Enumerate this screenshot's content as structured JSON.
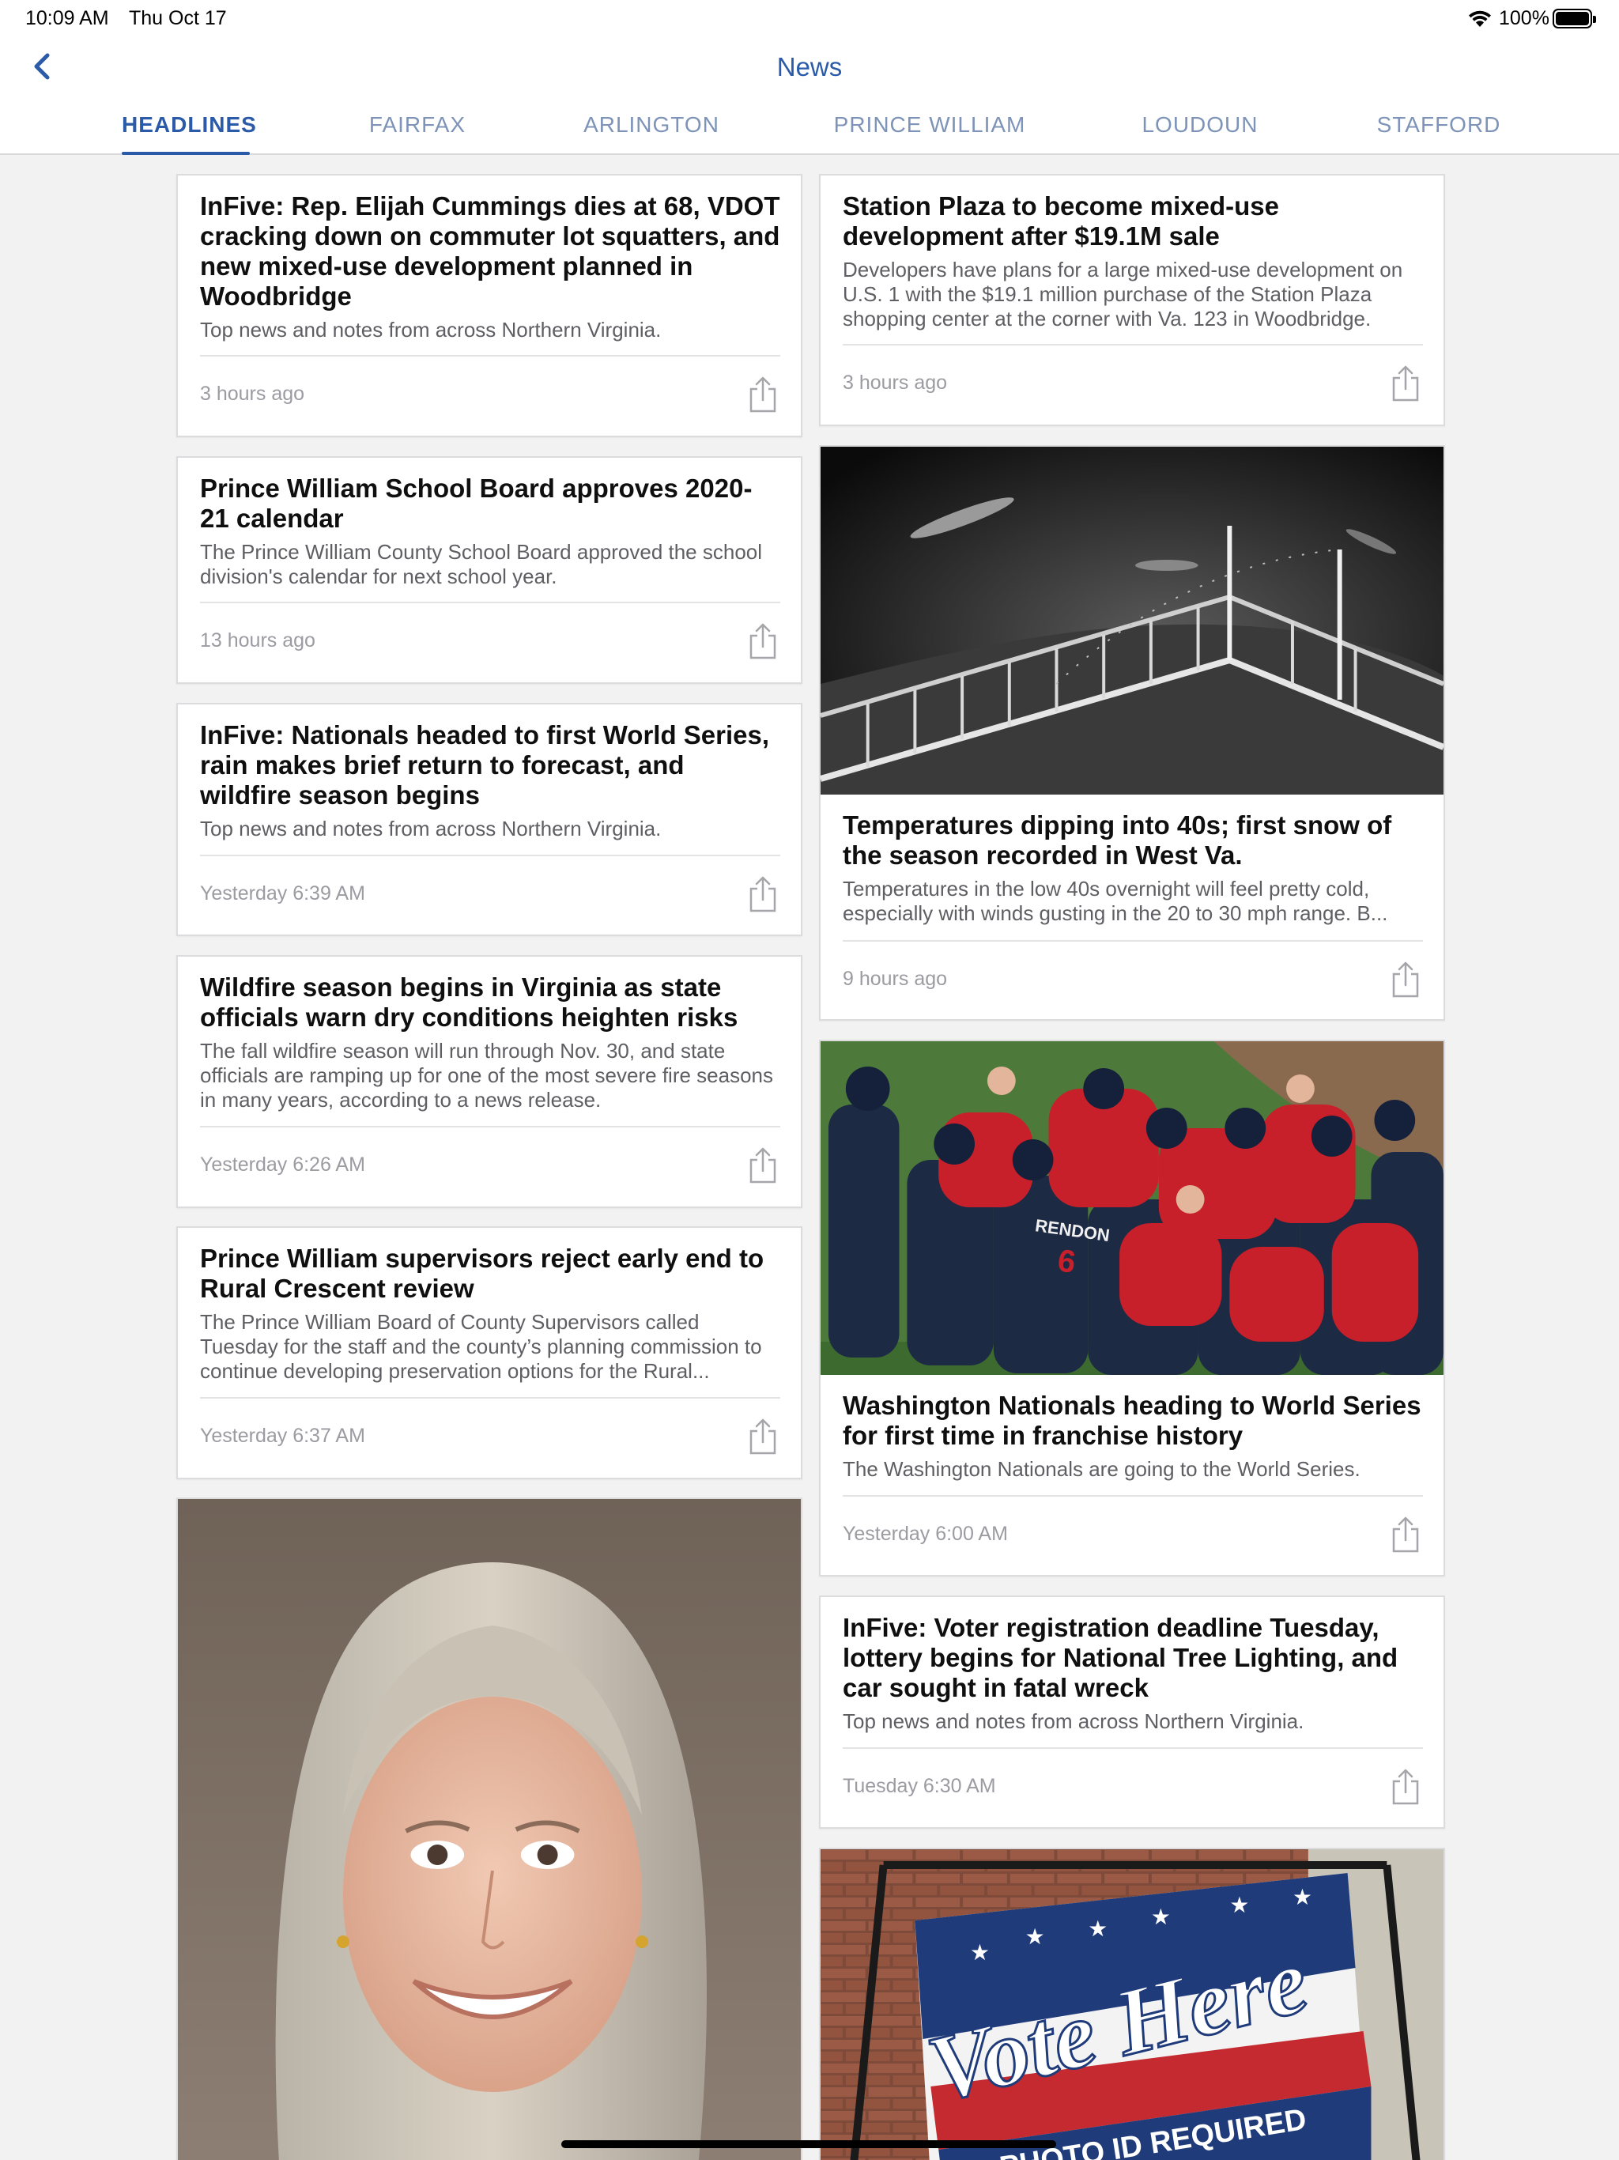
{
  "status_bar": {
    "time": "10:09 AM",
    "date": "Thu Oct 17",
    "battery_percent": "100%",
    "icons": [
      "wifi-icon",
      "battery-icon"
    ]
  },
  "header": {
    "title": "News",
    "back_icon": "chevron-left-icon",
    "tabs": [
      {
        "label": "HEADLINES",
        "active": true
      },
      {
        "label": "FAIRFAX",
        "active": false
      },
      {
        "label": "ARLINGTON",
        "active": false
      },
      {
        "label": "PRINCE WILLIAM",
        "active": false
      },
      {
        "label": "LOUDOUN",
        "active": false
      },
      {
        "label": "STAFFORD",
        "active": false
      }
    ]
  },
  "colors": {
    "accent": "#2a5aa8",
    "tab_inactive": "#7d93b8",
    "background": "#f2f2f3"
  },
  "articles": {
    "left": [
      {
        "title": "InFive: Rep. Elijah Cummings dies at 68, VDOT cracking down on commuter lot squatters, and new mixed-use development planned in Woodbridge",
        "summary": "Top news and notes from across Northern Virginia.",
        "time": "3 hours ago"
      },
      {
        "title": "Prince William School Board approves 2020-21 calendar",
        "summary": "The Prince William County School Board approved the school division's calendar for next school year.",
        "time": "13 hours ago"
      },
      {
        "title": "InFive: Nationals headed to first World Series, rain makes brief return to forecast, and wildfire season begins",
        "summary": "Top news and notes from across Northern Virginia.",
        "time": "Yesterday 6:39 AM"
      },
      {
        "title": "Wildfire season begins in Virginia as state officials warn dry conditions heighten risks",
        "summary": "The fall wildfire season will run through Nov. 30, and state officials are ramping up for one of the most severe fire seasons in many years, according to a news release.",
        "time": "Yesterday 6:26 AM"
      },
      {
        "title": "Prince William supervisors reject early end to Rural Crescent review",
        "summary": "The Prince William Board of County Supervisors called Tuesday for the staff and the county’s planning commission to continue developing preservation options for the Rural...",
        "time": "Yesterday 6:37 AM"
      }
    ],
    "right": [
      {
        "title": "Station Plaza to become mixed-use development after $19.1M sale",
        "summary": "Developers have plans for a large mixed-use development on U.S. 1 with the $19.1 million purchase of the Station Plaza shopping center at the corner with Va. 123 in Woodbridge.",
        "time": "3 hours ago"
      },
      {
        "title": "Temperatures dipping into 40s; first snow of the season recorded in West Va.",
        "summary": "Temperatures in the low 40s overnight will feel pretty cold, especially with winds gusting in the 20 to 30 mph range. B...",
        "time": "9 hours ago"
      },
      {
        "title": "Washington Nationals heading to World Series for first time in franchise history",
        "summary": "The Washington Nationals are going to the World Series.",
        "time": "Yesterday 6:00 AM"
      },
      {
        "title": "InFive: Voter registration deadline Tuesday, lottery begins for National Tree Lighting, and car sought in fatal wreck",
        "summary": "Top news and notes from across Northern Virginia.",
        "time": "Tuesday 6:30 AM"
      }
    ],
    "images": {
      "portrait_card": "portrait-photo",
      "vote_sign": {
        "headline": "Vote Here",
        "subline": "PHOTO ID REQUIRED"
      }
    }
  }
}
